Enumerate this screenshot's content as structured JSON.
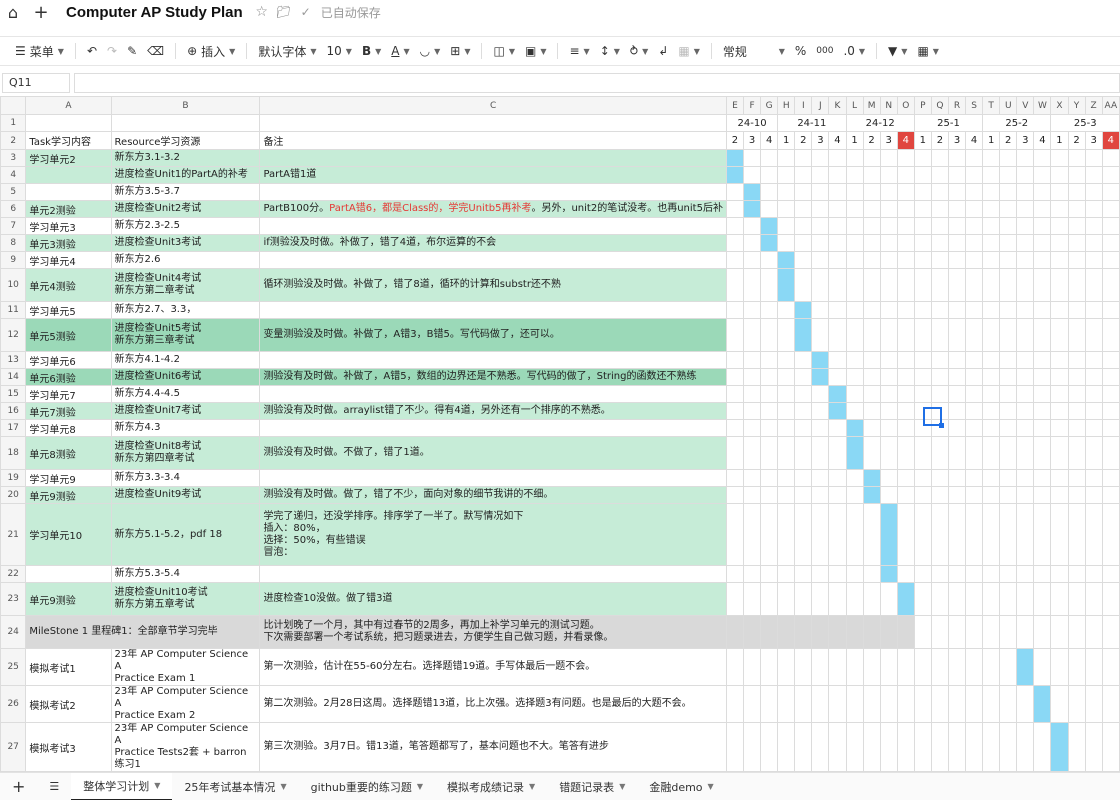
{
  "app": {
    "doc_title": "Computer AP Study Plan",
    "autosave": "已自动保存"
  },
  "toolbar": {
    "menu": "菜单",
    "insert": "插入",
    "font": "默认字体",
    "font_size": "10",
    "bold": "B",
    "font_color": "A",
    "number_format": "常规",
    "percent": "%",
    "thousands": "000",
    "decimal": ".0"
  },
  "formula_bar": {
    "cell_ref": "Q11",
    "value": ""
  },
  "columns": {
    "row_num_header": "",
    "A": "A",
    "B": "B",
    "C": "C",
    "gantt": [
      "E",
      "F",
      "G",
      "H",
      "I",
      "J",
      "K",
      "L",
      "M",
      "N",
      "O",
      "P",
      "Q",
      "R",
      "S",
      "T",
      "U",
      "V",
      "W",
      "X",
      "Y",
      "Z",
      "AA"
    ]
  },
  "months": [
    {
      "label": "24-10",
      "span": 3
    },
    {
      "label": "24-11",
      "span": 4
    },
    {
      "label": "24-12",
      "span": 4
    },
    {
      "label": "25-1",
      "span": 4
    },
    {
      "label": "25-2",
      "span": 4
    },
    {
      "label": "25-3",
      "span": 4
    }
  ],
  "weeks": [
    "2",
    "3",
    "4",
    "1",
    "2",
    "3",
    "4",
    "1",
    "2",
    "3",
    "4",
    "1",
    "2",
    "3",
    "4",
    "1",
    "2",
    "3",
    "4",
    "1",
    "2",
    "3",
    "4"
  ],
  "red_week_indices": [
    10,
    22
  ],
  "header_row": {
    "task": "Task学习内容",
    "resource": "Resource学习资源",
    "note": "备注"
  },
  "rows": [
    {
      "num": "3",
      "task": "学习单元2",
      "res": "新东方3.1-3.2",
      "note": "",
      "style": "green",
      "bar": [
        0
      ]
    },
    {
      "num": "4",
      "task": "",
      "res": "进度检查Unit1的PartA的补考",
      "note": "PartA错1道",
      "style": "green",
      "bar": [
        0
      ]
    },
    {
      "num": "5",
      "task": "",
      "res": "新东方3.5-3.7",
      "note": "",
      "style": "white",
      "bar": [
        1
      ]
    },
    {
      "num": "6",
      "task": "单元2测验",
      "res": "进度检查Unit2考试",
      "note_pre": "PartB100分。",
      "note_hl": "PartA错6，都是Class的，学完Unitb5再补考",
      "note_post": "。另外，unit2的笔试没考。也再unit5后补",
      "style": "green",
      "bar": [
        1
      ]
    },
    {
      "num": "7",
      "task": "学习单元3",
      "res": "新东方2.3-2.5",
      "note": "",
      "style": "white",
      "bar": [
        2
      ]
    },
    {
      "num": "8",
      "task": "单元3测验",
      "res": "进度检查Unit3考试",
      "note": "if测验没及时做。补做了，错了4道，布尔运算的不会",
      "style": "green",
      "bar": [
        2
      ]
    },
    {
      "num": "9",
      "task": "学习单元4",
      "res": "新东方2.6",
      "note": "",
      "style": "white",
      "bar": [
        3
      ]
    },
    {
      "num": "10",
      "task": "单元4测验",
      "res": "进度检查Unit4考试\n新东方第二章考试",
      "note": "循环测验没及时做。补做了，错了8道，循环的计算和substr还不熟",
      "style": "green",
      "bar": [
        3
      ],
      "tall": true
    },
    {
      "num": "11",
      "task": "学习单元5",
      "res": "新东方2.7、3.3，",
      "note": "",
      "style": "white",
      "bar": [
        4
      ]
    },
    {
      "num": "12",
      "task": "单元5测验",
      "res": "进度检查Unit5考试\n新东方第三章考试",
      "note": "变量测验没及时做。补做了，A错3，B错5。写代码做了，还可以。",
      "style": "gdark",
      "bar": [
        4
      ],
      "tall": true
    },
    {
      "num": "13",
      "task": "学习单元6",
      "res": "新东方4.1-4.2",
      "note": "",
      "style": "white",
      "bar": [
        5
      ]
    },
    {
      "num": "14",
      "task": "单元6测验",
      "res": "进度检查Unit6考试",
      "note": "测验没有及时做。补做了，A错5，数组的边界还是不熟悉。写代码的做了，String的函数还不熟练",
      "style": "gdark",
      "bar": [
        5
      ]
    },
    {
      "num": "15",
      "task": "学习单元7",
      "res": "新东方4.4-4.5",
      "note": "",
      "style": "white",
      "bar": [
        6
      ]
    },
    {
      "num": "16",
      "task": "单元7测验",
      "res": "进度检查Unit7考试",
      "note": "测验没有及时做。arraylist错了不少。得有4道，另外还有一个排序的不熟悉。",
      "style": "green",
      "bar": [
        6
      ]
    },
    {
      "num": "17",
      "task": "学习单元8",
      "res": "新东方4.3",
      "note": "",
      "style": "white",
      "bar": [
        7
      ]
    },
    {
      "num": "18",
      "task": "单元8测验",
      "res": "进度检查Unit8考试\n新东方第四章考试",
      "note": "测验没有及时做。不做了，错了1道。",
      "style": "green",
      "bar": [
        7
      ],
      "tall": true
    },
    {
      "num": "19",
      "task": "学习单元9",
      "res": "新东方3.3-3.4",
      "note": "",
      "style": "white",
      "bar": [
        8
      ]
    },
    {
      "num": "20",
      "task": "单元9测验",
      "res": "进度检查Unit9考试",
      "note": "测验没有及时做。做了，错了不少，面向对象的细节我讲的不细。",
      "style": "green",
      "bar": [
        8
      ]
    },
    {
      "num": "21",
      "task": "学习单元10",
      "res": "新东方5.1-5.2，pdf 18",
      "note": "学完了递归，还没学排序。排序学了一半了。默写情况如下\n插入：80%，\n选择：50%，有些错误\n冒泡：",
      "style": "green",
      "bar": [
        9
      ],
      "xtall": true
    },
    {
      "num": "22",
      "task": "",
      "res": "新东方5.3-5.4",
      "note": "",
      "style": "white",
      "bar": [
        9
      ]
    },
    {
      "num": "23",
      "task": "单元9测验",
      "res": "进度检查Unit10考试\n新东方第五章考试",
      "note": "进度检查10没做。做了错3道",
      "style": "green",
      "bar": [
        10
      ],
      "tall": true
    },
    {
      "num": "24",
      "task": "MileStone 1 里程碑1：全部章节学习完毕",
      "res": "",
      "note": "比计划晚了一个月，其中有过春节的2周多，再加上补学习单元的测试习题。\n下次需要部署一个考试系统，把习题录进去，方便学生自己做习题，并看录像。",
      "style": "gray",
      "bar": [],
      "tall": true,
      "milestone": true
    },
    {
      "num": "25",
      "task": "模拟考试1",
      "res": "23年 AP Computer Science A\nPractice Exam 1",
      "note": "第一次测验，估计在55-60分左右。选择题错19道。手写体最后一题不会。",
      "style": "white",
      "bar": [
        17
      ],
      "tall": true
    },
    {
      "num": "26",
      "task": "模拟考试2",
      "res": "23年 AP Computer Science A\nPractice Exam 2",
      "note": "第二次测验。2月28日这周。选择题错13道，比上次强。选择题3有问题。也是最后的大题不会。",
      "style": "white",
      "bar": [
        18
      ],
      "tall": true
    },
    {
      "num": "27",
      "task": "模拟考试3",
      "res": "23年 AP Computer Science A\nPractice Tests2套 + barron 练习1",
      "note": "第三次测验。3月7日。错13道，笔答题都写了，基本问题也不大。笔答有进步",
      "style": "white",
      "bar": [
        19
      ],
      "tall": true
    }
  ],
  "sheets": [
    {
      "label": "整体学习计划",
      "active": true
    },
    {
      "label": "25年考试基本情况",
      "active": false
    },
    {
      "label": "github重要的练习题",
      "active": false
    },
    {
      "label": "模拟考成绩记录",
      "active": false
    },
    {
      "label": "错题记录表",
      "active": false
    },
    {
      "label": "金融demo",
      "active": false
    }
  ]
}
